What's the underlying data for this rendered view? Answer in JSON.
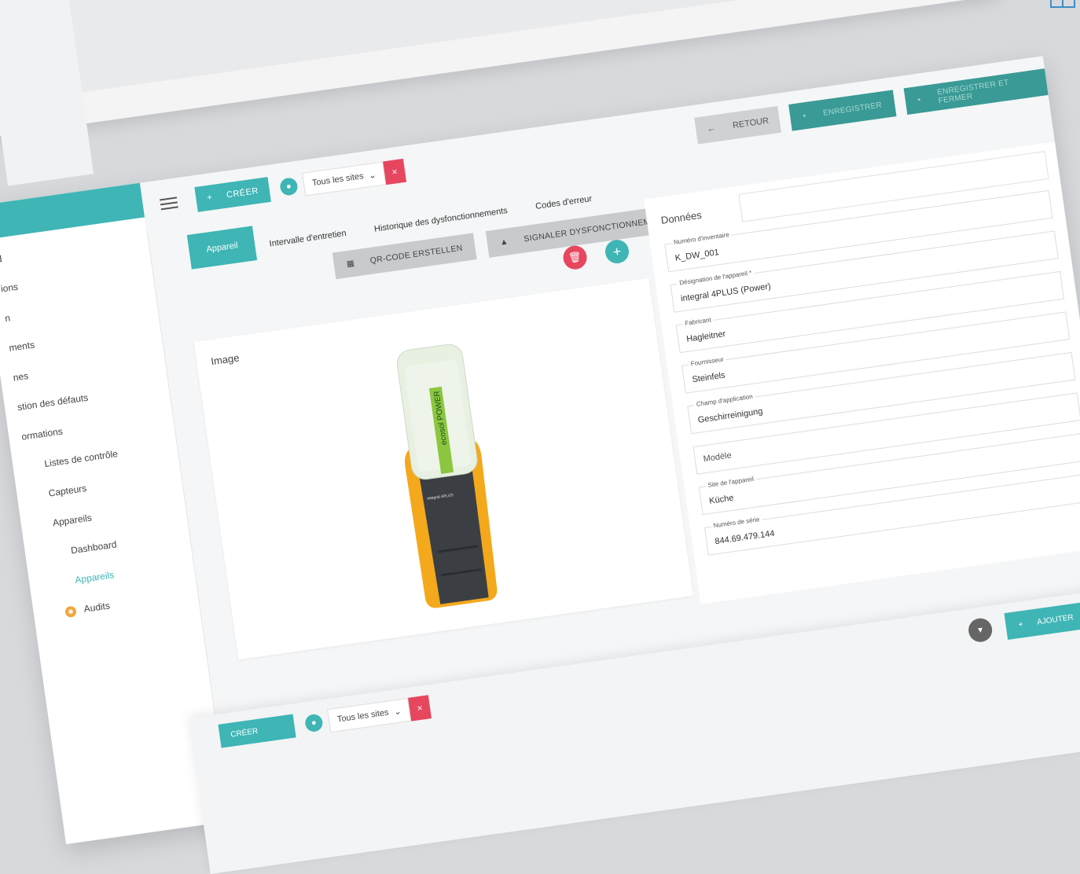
{
  "topbar": {
    "create_label": "CRÉER",
    "site_select_value": "Tous les sites",
    "clear_icon": "×"
  },
  "actions": {
    "back_label": "RETOUR",
    "save_label": "ENREGISTRER",
    "save_close_label": "ENREGISTRER ET FERMER"
  },
  "tabs": [
    {
      "label": "Appareil"
    },
    {
      "label": "Intervalle d'entretien"
    },
    {
      "label": "Historique des dysfonctionnements"
    },
    {
      "label": "Codes d'erreur"
    }
  ],
  "subbar": {
    "qr_label": "QR-CODE ERSTELLEN",
    "report_label": "SIGNALER DYSFONCTIONNEMENT"
  },
  "sidebar": {
    "items": [
      {
        "label": "d"
      },
      {
        "label": "ions"
      },
      {
        "label": "n"
      },
      {
        "label": "ments"
      },
      {
        "label": "nes"
      },
      {
        "label": "stion des défauts"
      },
      {
        "label": "ormations"
      },
      {
        "label": "Listes de contrôle"
      },
      {
        "label": "Capteurs"
      },
      {
        "label": "Appareils"
      },
      {
        "label": "Dashboard"
      },
      {
        "label": "Appareils"
      },
      {
        "label": "Audits"
      }
    ]
  },
  "image_card": {
    "title": "Image",
    "product_brand": "ecosol POWER",
    "product_model": "integral 4PLUS"
  },
  "data_card": {
    "title": "Données",
    "fields": [
      {
        "label": "Numéro d'inventaire",
        "value": "K_DW_001"
      },
      {
        "label": "Désignation de l'appareil *",
        "value": "integral 4PLUS (Power)"
      },
      {
        "label": "Fabricant",
        "value": "Hagleitner"
      },
      {
        "label": "Fournisseur",
        "value": "Steinfels"
      },
      {
        "label": "Champ d'application",
        "value": "Geschirreinigung"
      },
      {
        "label": "",
        "value": "Modèle"
      },
      {
        "label": "Site de l'appareil",
        "value": "Küche"
      },
      {
        "label": "Numéro de série",
        "value": "844.69.479.144"
      }
    ]
  },
  "lower": {
    "create_label": "CRÉER",
    "site_select_value": "Tous les sites",
    "add_label": "AJOUTER"
  },
  "colors": {
    "accent": "#3fb5b5",
    "danger": "#e7465f",
    "save": "#3a9a95"
  }
}
